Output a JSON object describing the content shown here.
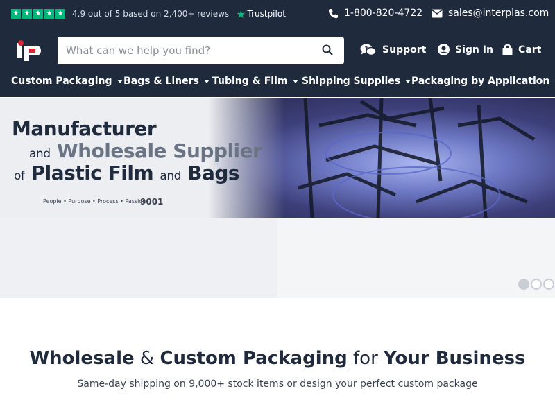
{
  "topbar": {
    "rating_text": "4.9 out of 5 based on 2,400+ reviews",
    "trustpilot": "Trustpilot",
    "phone": "1-800-820-4722",
    "email": "sales@interplas.com"
  },
  "header": {
    "search_placeholder": "What can we help you find?",
    "support": "Support",
    "sign_in": "Sign In",
    "cart": "Cart"
  },
  "nav": {
    "items": [
      {
        "label": "Custom Packaging"
      },
      {
        "label": "Bags & Liners"
      },
      {
        "label": "Tubing & Film"
      },
      {
        "label": "Shipping Supplies"
      },
      {
        "label": "Packaging by Application"
      }
    ]
  },
  "hero": {
    "line1": "Manufacturer",
    "line2_small": "and",
    "line2_big": "Wholesale Supplier",
    "line3_small1": "of",
    "line3_big1": "Plastic Film",
    "line3_small2": "and",
    "line3_big2": "Bags",
    "tagline": "People • Purpose • Process • Passion",
    "iso": "9001",
    "slides": 3,
    "active_slide": 1
  },
  "main": {
    "title_parts": [
      "Wholesale",
      "&",
      "Custom Packaging",
      "for",
      "Your Business"
    ],
    "subtitle": "Same-day shipping on 9,000+ stock items or design your perfect custom package"
  },
  "colors": {
    "navy": "#1f2a3d",
    "trustpilot_green": "#00b67a"
  }
}
